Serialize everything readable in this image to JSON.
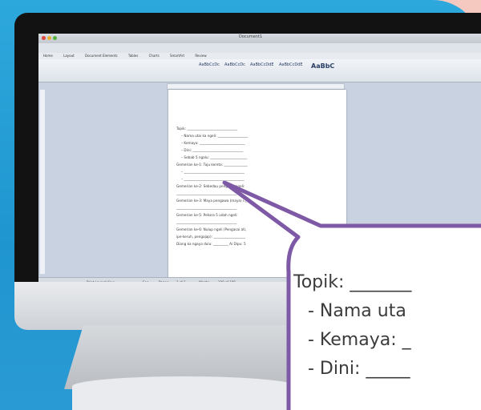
{
  "app": {
    "window_title": "Document1",
    "ribbon_tabs": [
      "Home",
      "Layout",
      "Document Elements",
      "Tables",
      "Charts",
      "SmartArt",
      "Review"
    ],
    "style_samples": [
      "AaBbCcDc",
      "AaBbCcDc",
      "AaBbCcDdE",
      "AaBbCcDdE",
      "AaBbC"
    ],
    "statusbar": [
      "Print Layout View",
      "Sec",
      "Pages:",
      "1 of 1",
      "Words:",
      "100 of 100"
    ]
  },
  "document": {
    "lines": [
      {
        "text": "Topik: ______________________________",
        "indent": false
      },
      {
        "text": "–  Nama utai ka ngeli: __________________",
        "indent": true
      },
      {
        "text": "–  Kemaya: ___________________________",
        "indent": true
      },
      {
        "text": "–  Dini: ______________________________",
        "indent": true
      },
      {
        "text": "–  Sebab 5 ngalu: ______________________",
        "indent": true
      },
      {
        "text": "Gemerian ke-1: Tuju kereta: ______________",
        "indent": false
      },
      {
        "text": "–  ____________________________________",
        "indent": true
      },
      {
        "text": "–  ____________________________________",
        "indent": true
      },
      {
        "text": "Gemerian ke-2: Sebedau pengawa ngeli:",
        "indent": false
      },
      {
        "text": "____________________________________",
        "indent": false
      },
      {
        "text": "Gemerian ke-3: Maya pengawa (maya) ngeli:",
        "indent": false
      },
      {
        "text": "____________________________________",
        "indent": false
      },
      {
        "text": "Gemerian ke-5: Pekara 5 udah ngeli:",
        "indent": false
      },
      {
        "text": "____________________________________",
        "indent": false
      },
      {
        "text": "Gemerian ke-6: Nulup ngeli (Pengasai ati,",
        "indent": false
      },
      {
        "text": "ipe-keruh, pengajap): ___________________",
        "indent": false
      },
      {
        "text": "Diang ka ngaya dulu: _________   Ai Dipu: 5",
        "indent": false
      }
    ]
  },
  "bubble": {
    "topik_label": "Topik: _______",
    "lines": [
      "-   Nama uta",
      "-   Kemaya: _",
      "-   Dini: _____"
    ]
  },
  "colors": {
    "background_blue": "#2aa4da",
    "background_pink": "#f6c9c0",
    "bubble_fill": "#ffffff",
    "bubble_stroke": "#7e59a6"
  }
}
